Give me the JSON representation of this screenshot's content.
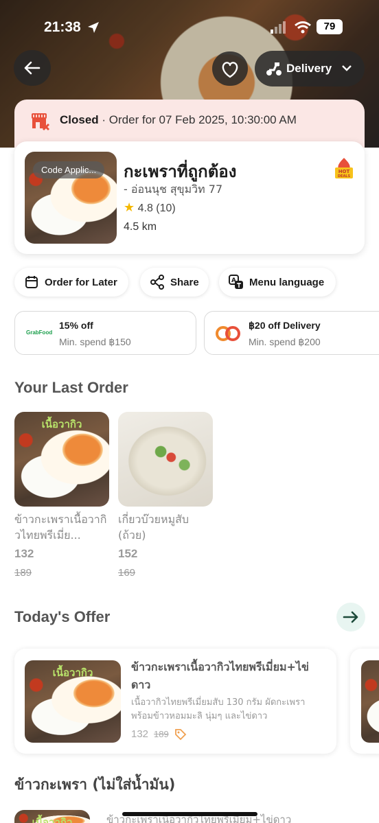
{
  "status_bar": {
    "time": "21:38",
    "battery": "79"
  },
  "header": {
    "delivery_label": "Delivery"
  },
  "closed_banner": {
    "status": "Closed",
    "detail": " · Order for 07 Feb 2025, 10:30:00 AM"
  },
  "restaurant": {
    "name": "กะเพราที่ถูกต้อง",
    "branch": "- อ่อนนุช สุขุมวิท 77",
    "rating": "4.8",
    "reviews": "(10)",
    "distance": "4.5 km",
    "image_tag": "Code Applic...",
    "badge_text": "HOT DEALS"
  },
  "actions": [
    {
      "label": "Order for Later",
      "icon": "calendar-icon"
    },
    {
      "label": "Share",
      "icon": "share-icon"
    },
    {
      "label": "Menu language",
      "icon": "translate-icon"
    }
  ],
  "promos": [
    {
      "logo": "GrabFood",
      "title": "15% off",
      "subtitle": "Min. spend ฿150"
    },
    {
      "logo": "linked-rings-icon",
      "title": "฿20 off Delivery",
      "subtitle": "Min. spend ฿200"
    }
  ],
  "last_order": {
    "title": "Your Last Order",
    "items": [
      {
        "image_label": "เนื้อวากิว",
        "name": "ข้าวกะเพราเนื้อวากิวไทยพรีเมี่ย...",
        "price": "132",
        "old_price": "189"
      },
      {
        "image_label": "",
        "name": "เกี่ยวบ๊วยหมูสับ (ถ้วย)",
        "price": "152",
        "old_price": "169"
      }
    ]
  },
  "todays_offer": {
    "title": "Today's Offer",
    "item": {
      "image_label": "เนื้อวากิว",
      "name": "ข้าวกะเพราเนื้อวากิวไทยพรีเมี่ยม+ไข่ดาว",
      "description": "เนื้อวากิวไทยพรีเมี่ยมสับ 130 กรัม ผัดกะเพรา พร้อมข้าวหอมมะลิ นุ่มๆ และไข่ดาว",
      "price": "132",
      "old_price": "189"
    }
  },
  "category": {
    "title": "ข้าวกะเพรา (ไม่ใส่น้ำมัน)",
    "peek_image_label": "เนื้อวากิว",
    "peek_name": "ข้าวกะเพราเนื้อวากิวไทยพรีเมี่ยม+ไข่ดาว"
  }
}
